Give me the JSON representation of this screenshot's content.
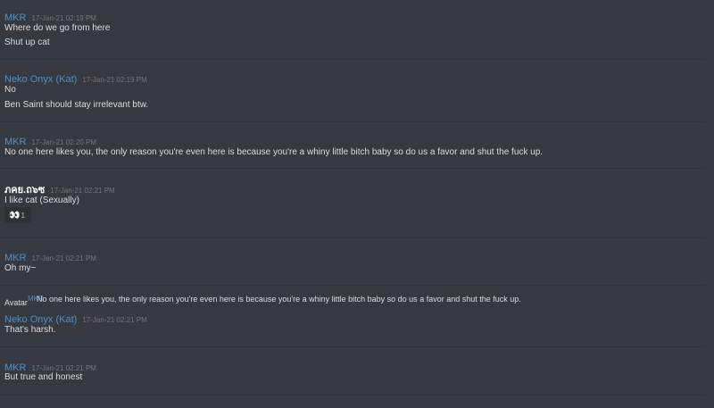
{
  "messages": [
    {
      "author": "MKR",
      "timestamp": "17-Jan-21 02:19 PM",
      "lines": [
        "Where do we go from  here",
        "Shut up cat"
      ]
    },
    {
      "author": "Neko Onyx (Kat)",
      "timestamp": "17-Jan-21 02:19 PM",
      "lines": [
        "No",
        "Ben Saint should stay irrelevant btw."
      ]
    },
    {
      "author": "MKR",
      "timestamp": "17-Jan-21 02:20 PM",
      "lines": [
        "No one here likes you, the only reason you're even here is because you're a whiny little bitch baby so do us a favor and shut the fuck up."
      ]
    },
    {
      "author": "ภคย.ถ๖ซ",
      "timestamp": "17-Jan-21 02:21 PM",
      "lines": [
        "I like cat (Sexually)"
      ],
      "reaction": {
        "emoji": "👀",
        "count": "1"
      }
    },
    {
      "author": "MKR",
      "timestamp": "17-Jan-21 02:21 PM",
      "lines": [
        "Oh my~"
      ]
    },
    {
      "author": "Neko Onyx (Kat)",
      "timestamp": "17-Jan-21 02:21 PM",
      "lines": [
        "That's harsh."
      ]
    },
    {
      "author": "MKR",
      "timestamp": "17-Jan-21 02:21 PM",
      "lines": [
        "But true and honest"
      ]
    }
  ],
  "reply_preview": {
    "avatar_alt": "Avatar",
    "author": "MKR",
    "text": "No one here likes you, the only reason you're even here is because you're a whiny little bitch baby so do us a favor and shut the fuck up."
  }
}
